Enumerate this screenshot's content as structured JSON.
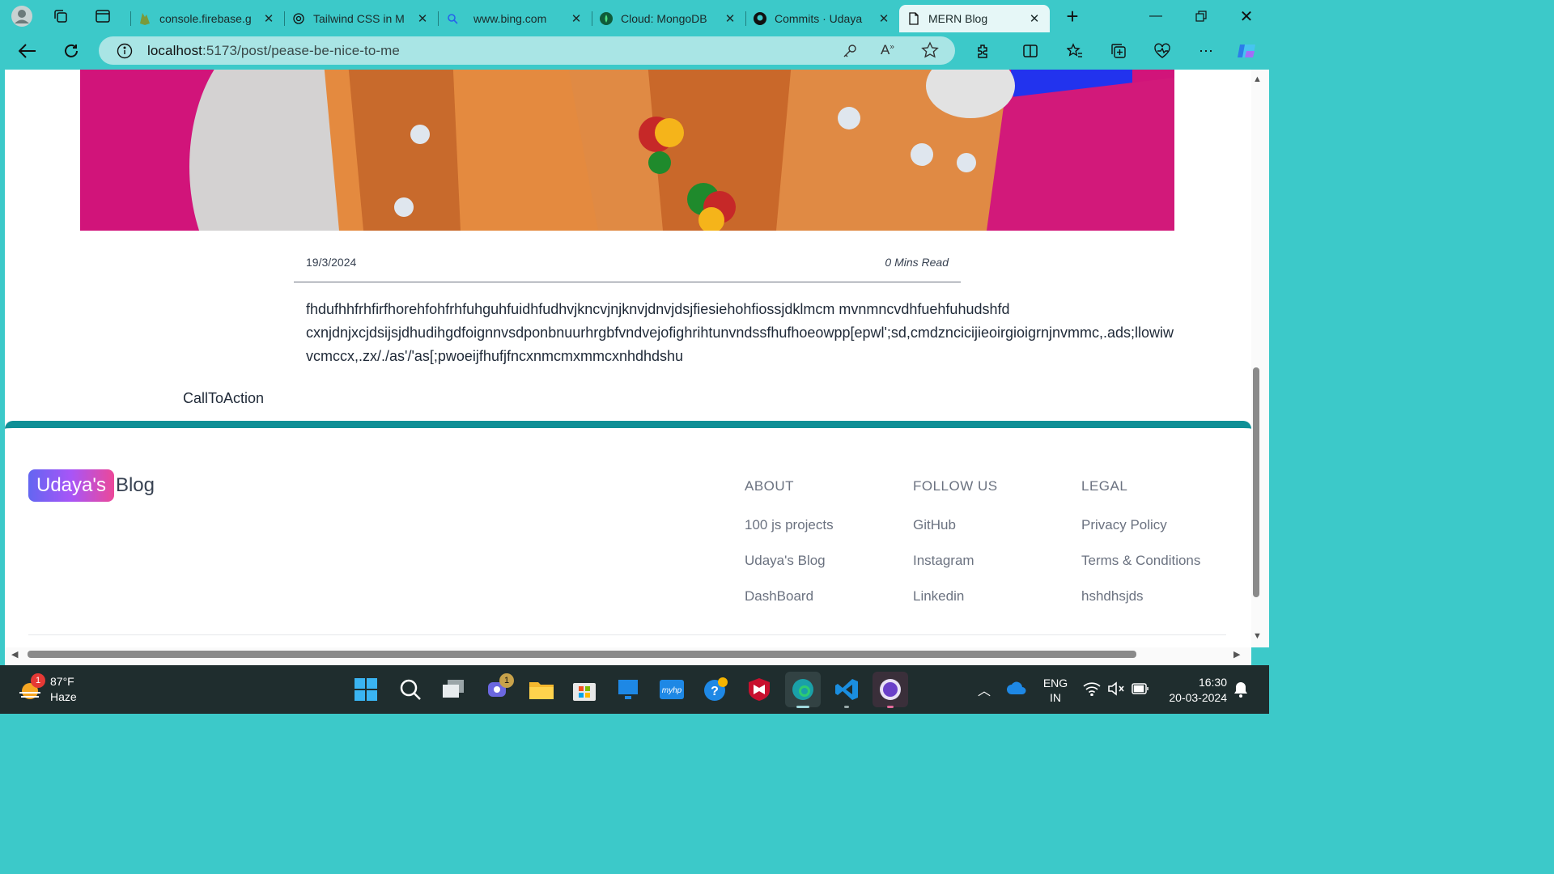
{
  "browser": {
    "tabs": [
      {
        "title": "console.firebase.g",
        "icon": "firebase-icon"
      },
      {
        "title": "Tailwind CSS in M",
        "icon": "chatgpt-icon"
      },
      {
        "title": "www.bing.com",
        "icon": "bing-search-icon"
      },
      {
        "title": "Cloud: MongoDB",
        "icon": "mongodb-icon"
      },
      {
        "title": "Commits · Udaya",
        "icon": "github-icon"
      },
      {
        "title": "MERN Blog",
        "icon": "page-icon",
        "active": true
      }
    ],
    "url_host": "localhost",
    "url_path": ":5173/post/pease-be-nice-to-me"
  },
  "post": {
    "date": "19/3/2024",
    "read_time": "0 Mins Read",
    "content_lines": [
      "fhdufhhfrhfirfhorehfohfrhfuhguhfuidhfudhvjkncvjnjknvjdnvjdsjfiesiehohfiossjdklmcm mvnmncvdhfuehfuhudshfd",
      "cxnjdnjxcjdsijsjdhudihgdfoignnvsdponbnuurhrgbfvndvejofighrihtunvndssfhufhoeowpp[epwl';sd,cmdzncicijieoirgioigrnjnvmmc,.ads;llowiw",
      "vcmccx,.zx/./as'/'as[;pwoeijfhufjfncxnmcmxmmcxnhdhdshu"
    ],
    "call_to_action": "CallToAction"
  },
  "footer": {
    "logo_badge": "Udaya's",
    "logo_rest": "Blog",
    "columns": [
      {
        "title": "ABOUT",
        "links": [
          "100 js projects",
          "Udaya's Blog",
          "DashBoard"
        ]
      },
      {
        "title": "FOLLOW US",
        "links": [
          "GitHub",
          "Instagram",
          "Linkedin"
        ]
      },
      {
        "title": "LEGAL",
        "links": [
          "Privacy Policy",
          "Terms & Conditions",
          "hshdhsjds"
        ]
      }
    ]
  },
  "taskbar": {
    "weather_temp": "87°F",
    "weather_cond": "Haze",
    "weather_badge": "1",
    "chat_badge": "1",
    "lang_1": "ENG",
    "lang_2": "IN",
    "time": "16:30",
    "date": "20-03-2024"
  },
  "colors": {
    "browser_chrome": "#3cc9c9",
    "footer_accent": "#0e8f96",
    "logo_gradient": [
      "#6366f1",
      "#a855f7",
      "#ec4899"
    ]
  }
}
